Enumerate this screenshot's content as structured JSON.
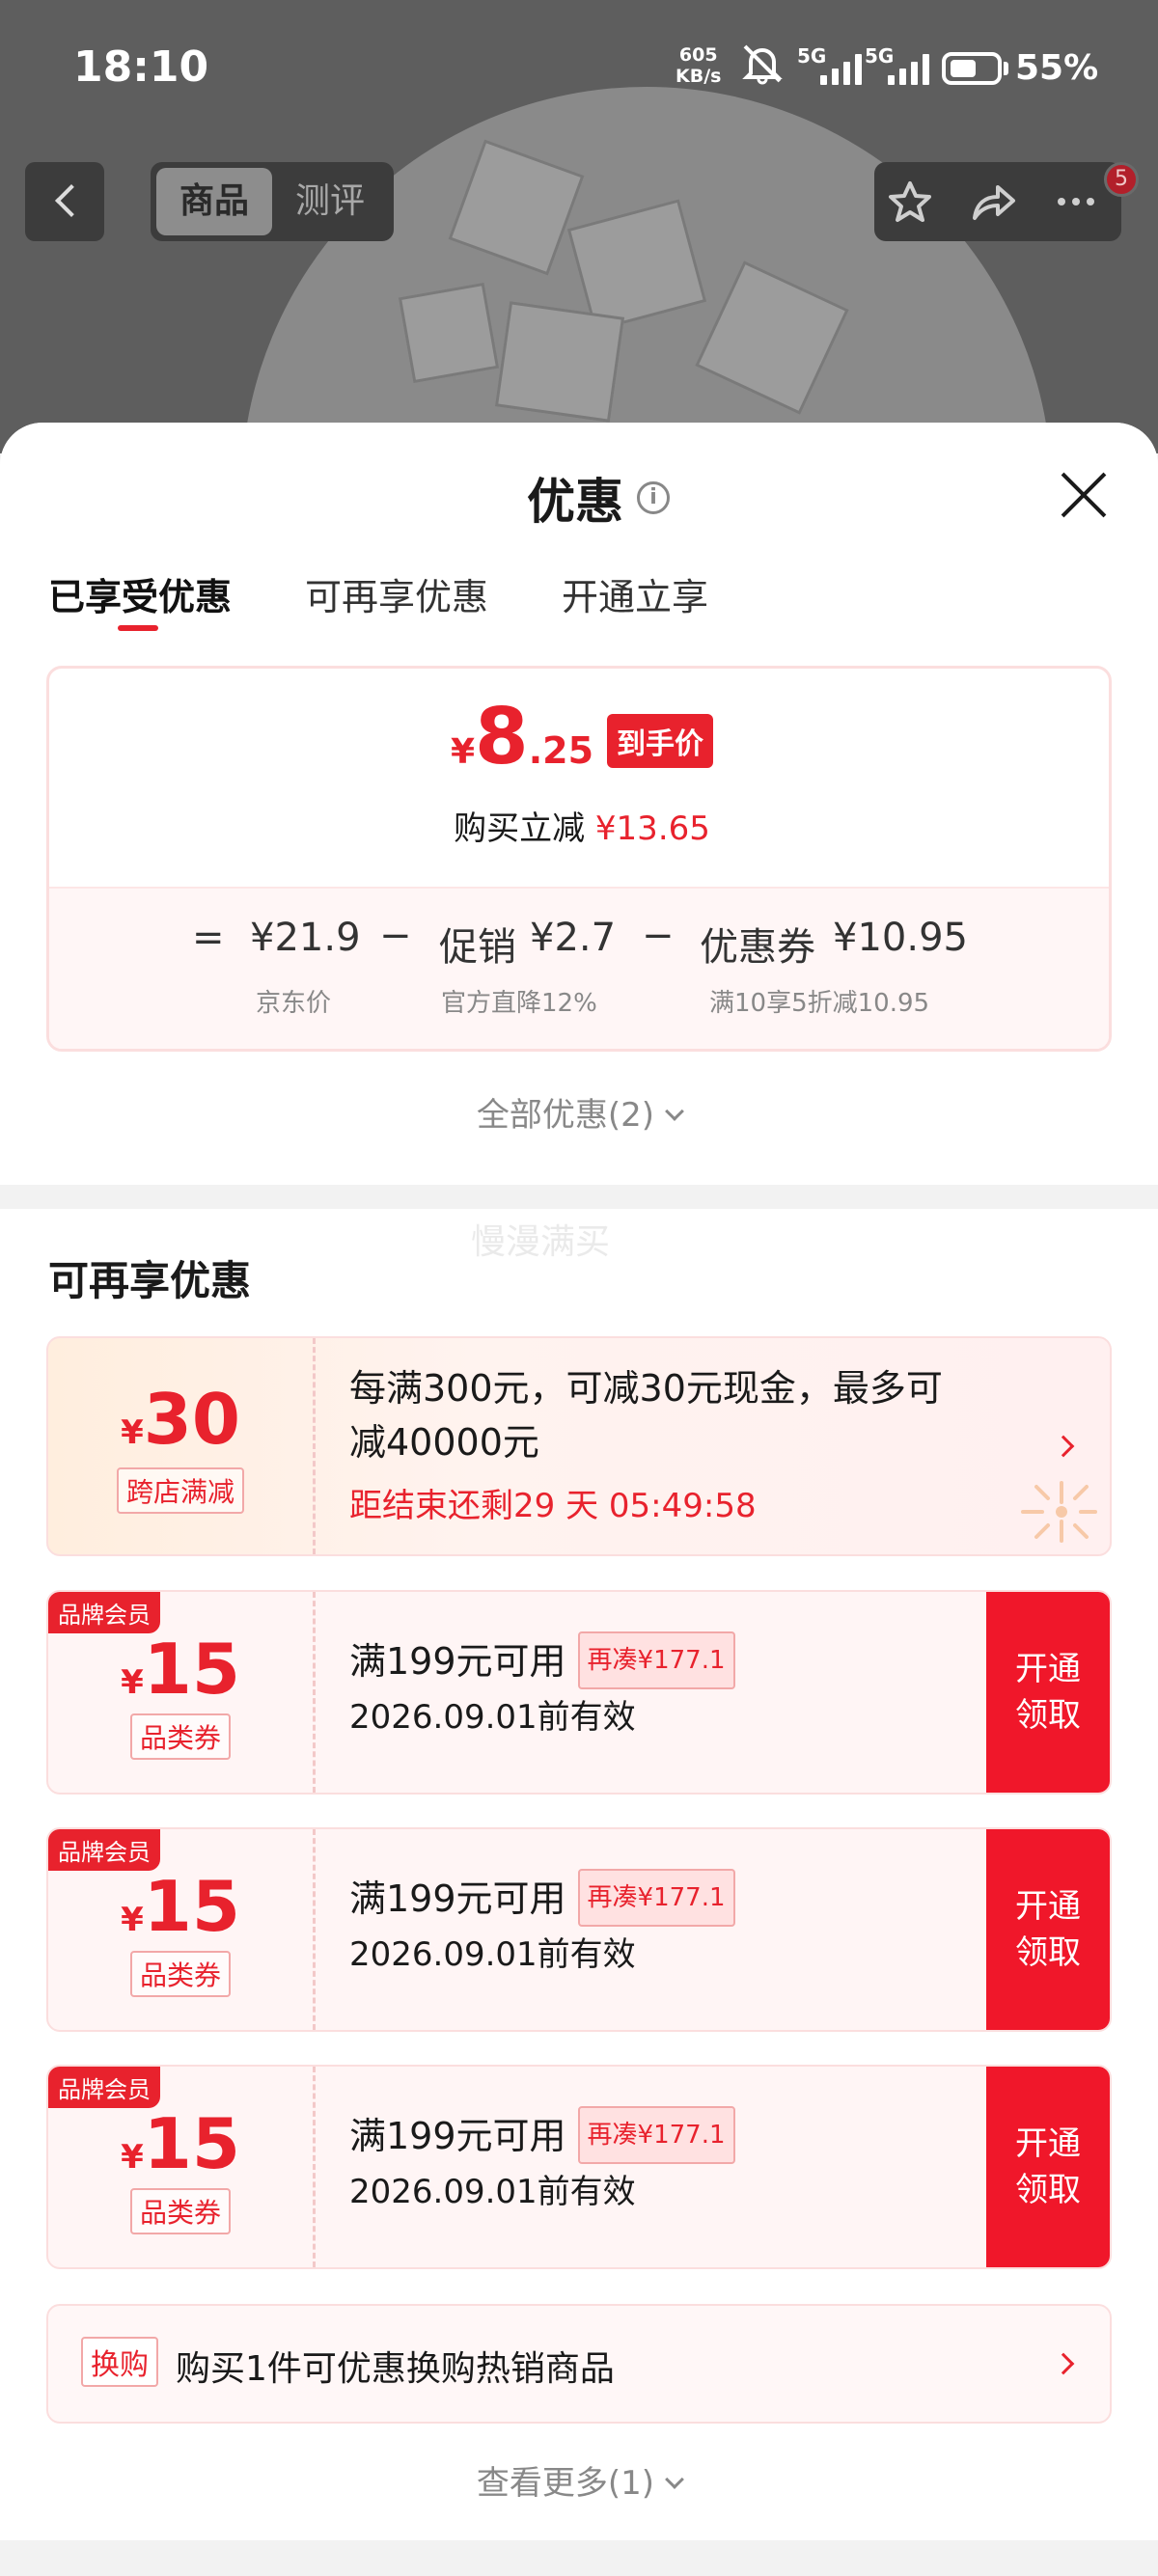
{
  "status_bar": {
    "time": "18:10",
    "net_speed_value": "605",
    "net_speed_unit": "KB/s",
    "signal1_label": "5G",
    "signal2_label": "5G",
    "battery": "55%"
  },
  "top_nav": {
    "tabs": [
      "商品",
      "测评"
    ],
    "active_tab": "商品",
    "menu_badge": "5"
  },
  "sheet": {
    "title": "优惠",
    "info_symbol": "i",
    "tabs": [
      "已享受优惠",
      "可再享优惠",
      "开通立享"
    ],
    "active_tab": "已享受优惠"
  },
  "price_summary": {
    "currency": "¥",
    "final_int": "8",
    "final_dec": ".25",
    "final_tag": "到手价",
    "reduce_label": "购买立减",
    "reduce_value": "¥13.65",
    "equals": "=",
    "minus": "−",
    "jd_price": "¥21.9",
    "jd_price_label": "京东价",
    "promo_label": "促销",
    "promo_value": "¥2.7",
    "promo_sub": "官方直降12%",
    "coupon_label": "优惠券",
    "coupon_value": "¥10.95",
    "coupon_sub": "满10享5折减10.95"
  },
  "all_promos": "全部优惠(2)",
  "watermark": "慢漫满买",
  "section": {
    "title": "可再享优惠"
  },
  "cross_store": {
    "currency": "¥",
    "amount": "30",
    "tag": "跨店满减",
    "desc_line1": "每满300元，可减30元现金，最多可",
    "desc_line2": "减40000元",
    "countdown": "距结束还剩29 天 05:49:58"
  },
  "coupons": [
    {
      "corner": "品牌会员",
      "currency": "¥",
      "amount": "15",
      "tag": "品类券",
      "cond": "满199元可用",
      "need": "再凑¥177.1",
      "expiry": "2026.09.01前有效",
      "btn1": "开通",
      "btn2": "领取"
    },
    {
      "corner": "品牌会员",
      "currency": "¥",
      "amount": "15",
      "tag": "品类券",
      "cond": "满199元可用",
      "need": "再凑¥177.1",
      "expiry": "2026.09.01前有效",
      "btn1": "开通",
      "btn2": "领取"
    },
    {
      "corner": "品牌会员",
      "currency": "¥",
      "amount": "15",
      "tag": "品类券",
      "cond": "满199元可用",
      "need": "再凑¥177.1",
      "expiry": "2026.09.01前有效",
      "btn1": "开通",
      "btn2": "领取"
    }
  ],
  "swap": {
    "tag": "换购",
    "text": "购买1件可优惠换购热销商品"
  },
  "see_more": "查看更多(1)",
  "colors": {
    "accent_red": "#e8222d",
    "button_red": "#f0172a",
    "card_border": "#fbdede"
  },
  "icons": [
    "back-icon",
    "star-icon",
    "share-icon",
    "more-icon",
    "info-icon",
    "close-icon",
    "chevron-right-icon",
    "chevron-down-icon",
    "mute-icon",
    "battery-icon"
  ]
}
